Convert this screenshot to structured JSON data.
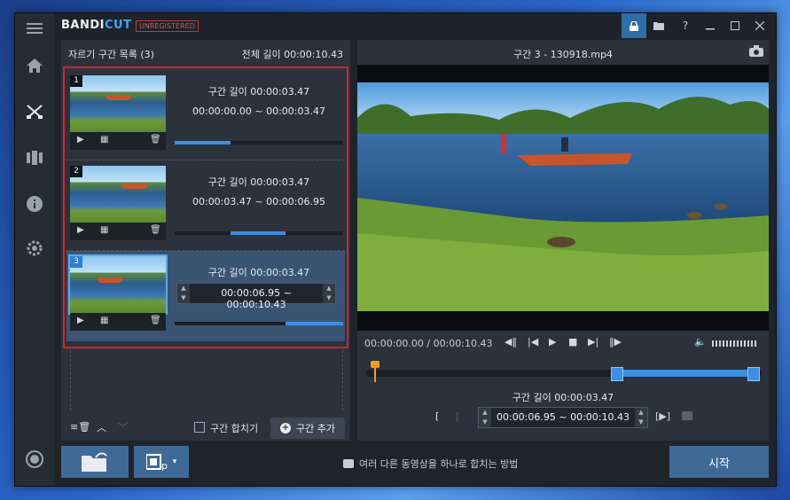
{
  "app": {
    "logo_main": "BANDI",
    "logo_accent": "CUT",
    "badge": "UNREGISTERED"
  },
  "titlebar_buttons": [
    "lock-icon",
    "folder-icon",
    "help-icon",
    "minimize-icon",
    "maximize-icon",
    "close-icon"
  ],
  "sidebar": [
    "menu-icon",
    "home-icon",
    "cut-icon",
    "join-icon",
    "info-icon",
    "settings-icon",
    "record-icon"
  ],
  "left_panel": {
    "title": "자르기 구간 목록 (3)",
    "total": "전체 길이 00:00:10.43",
    "clips": [
      {
        "num": "1",
        "length": "구간 길이 00:00:03.47",
        "range": "00:00:00.00 ~ 00:00:03.47",
        "progress": 0.33
      },
      {
        "num": "2",
        "length": "구간 길이 00:00:03.47",
        "range": "00:00:03.47 ~ 00:00:06.95",
        "progress_start": 0.33,
        "progress_end": 0.66
      },
      {
        "num": "3",
        "length": "구간 길이 00:00:03.47",
        "range": "00:00:06.95 ~ 00:00:10.43",
        "progress_start": 0.66,
        "progress_end": 1.0
      }
    ],
    "merge_label": "구간 합치기",
    "add_label": "구간 추가"
  },
  "right_panel": {
    "title": "구간 3 - 130918.mp4",
    "time": "00:00:00.00 / 00:00:10.43",
    "segment_length": "구간 길이 00:00:03.47",
    "range": "00:00:06.95 ~ 00:00:10.43"
  },
  "bottom": {
    "hint": "여러 다른 동영상을 하나로 합치는 방법",
    "start": "시작"
  },
  "colors": {
    "accent": "#3d8fe0",
    "selection": "#3a5474",
    "highlight_border": "#d4242a",
    "playhead": "#f0a020"
  }
}
